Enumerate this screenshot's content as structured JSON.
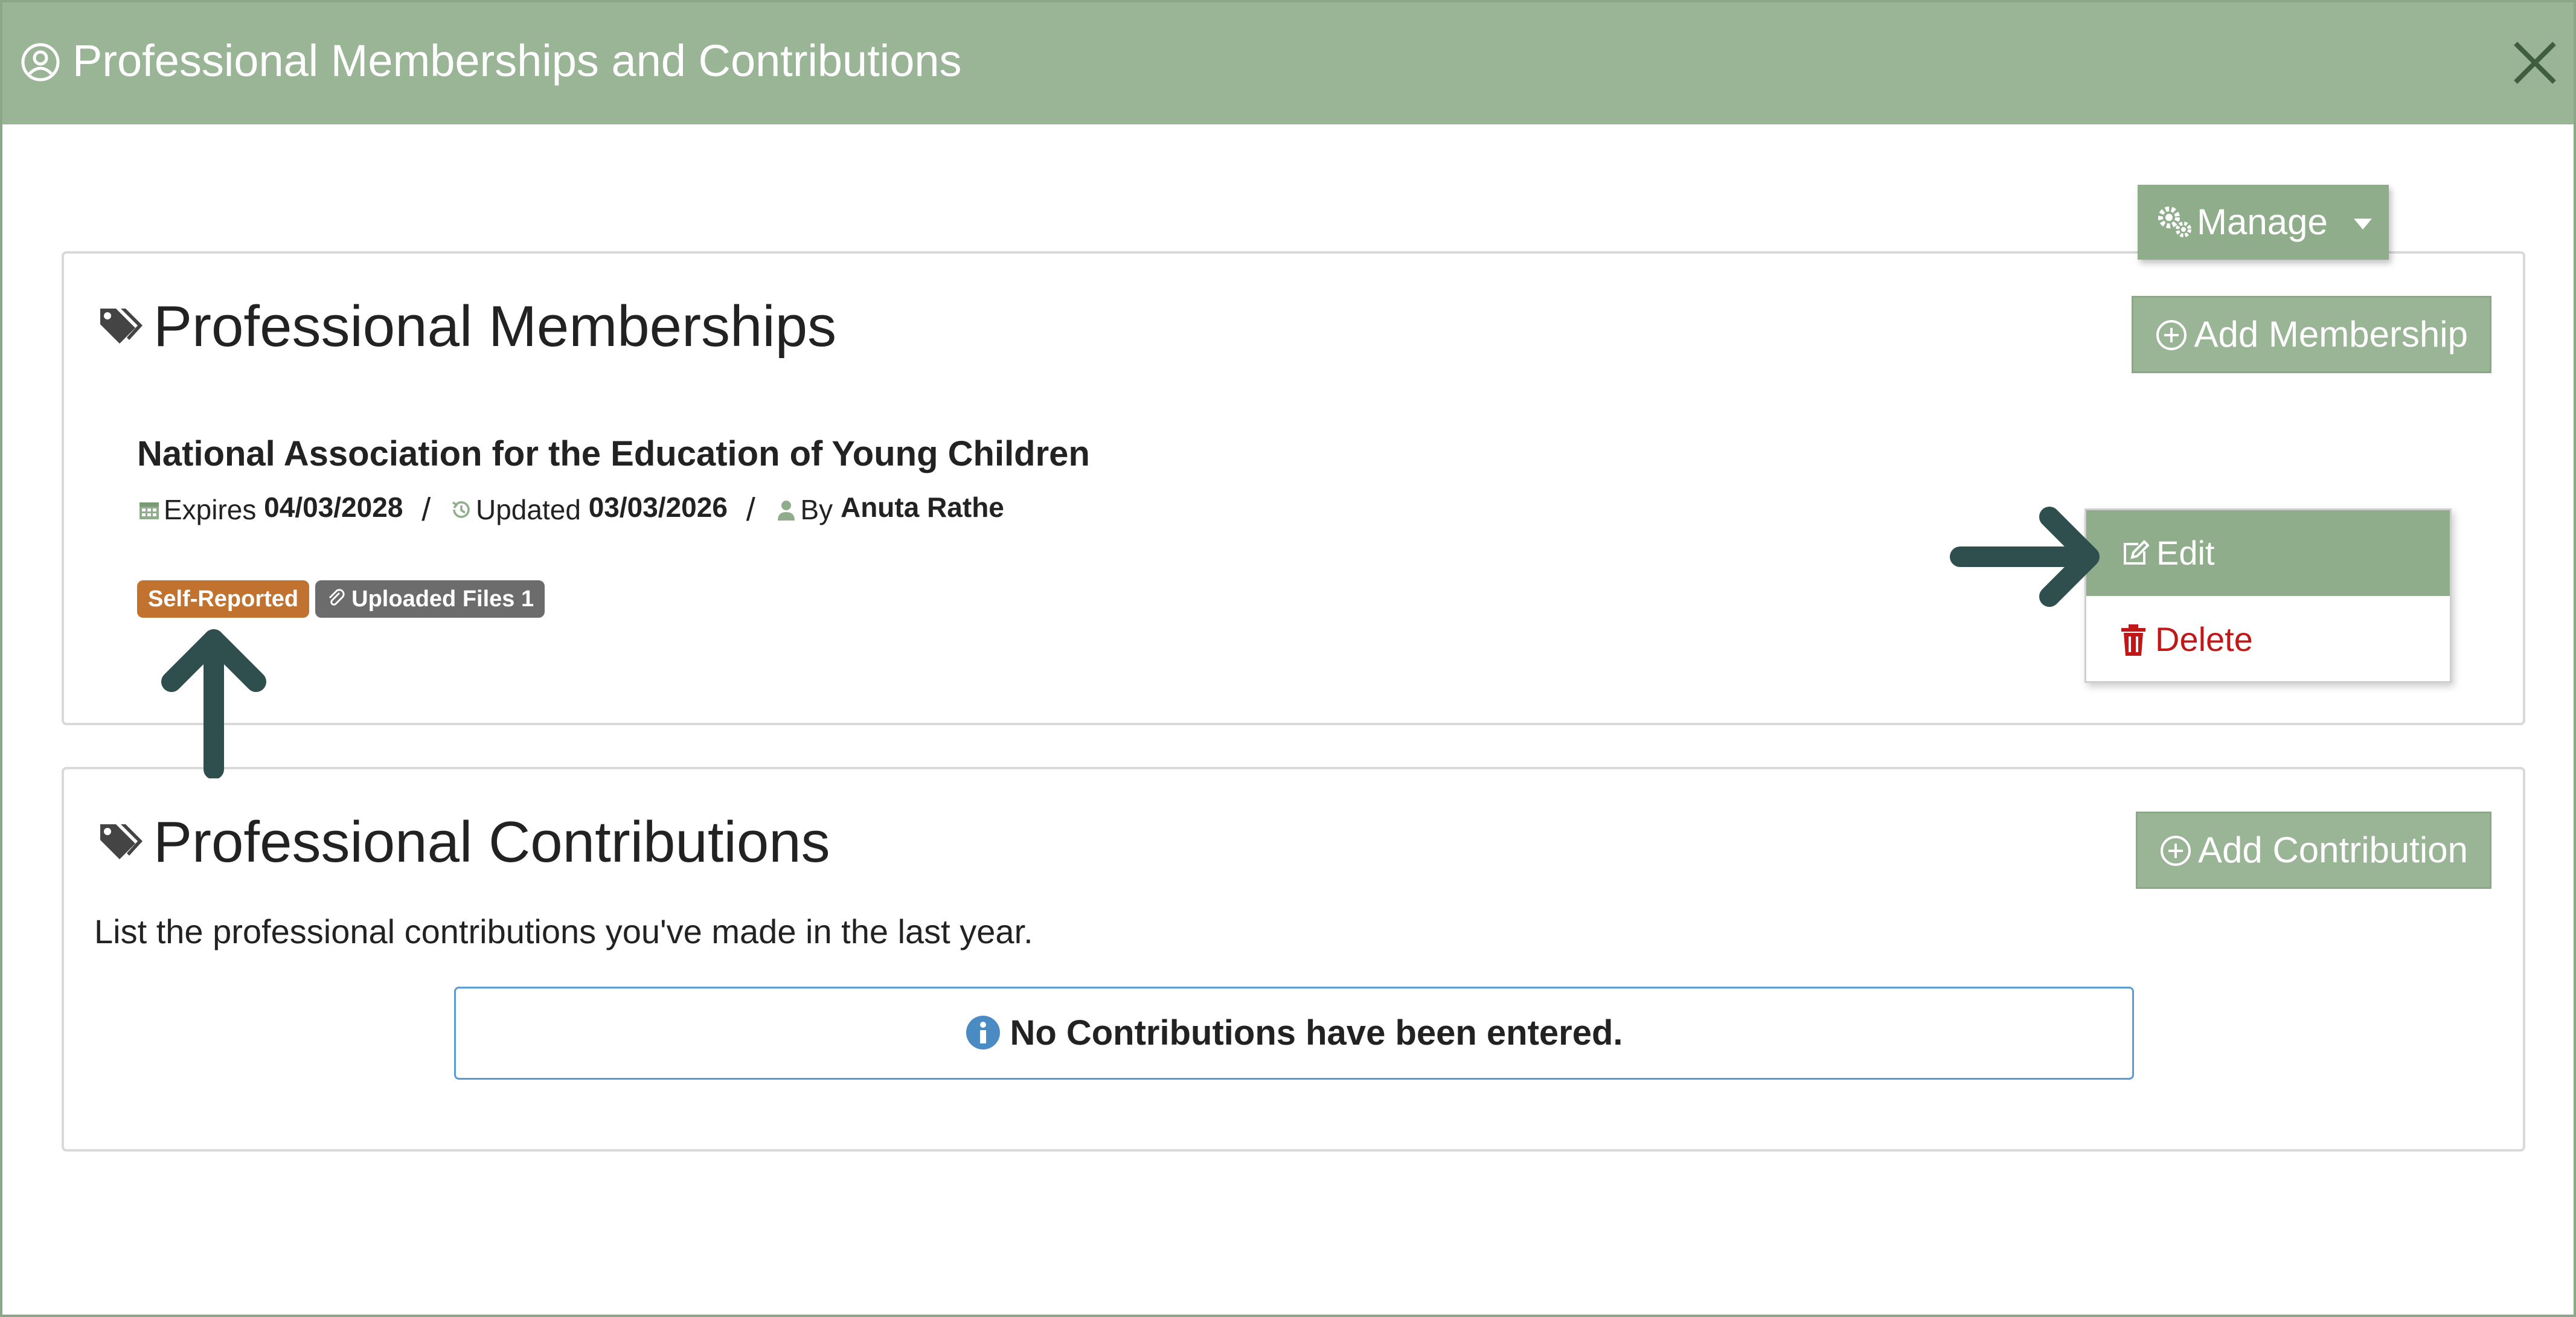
{
  "modal": {
    "title": "Professional Memberships and Contributions",
    "header_color": "#9ab596"
  },
  "memberships": {
    "title": "Professional Memberships",
    "add_label": "Add Membership",
    "item": {
      "name": "National Association for the Education of Young Children",
      "expires_label": "Expires",
      "expires_date": "04/03/2028",
      "updated_label": "Updated",
      "updated_date": "03/03/2026",
      "by_label": "By",
      "by_name": "Anuta Rathe",
      "badge_self": "Self-Reported",
      "badge_files": "Uploaded Files 1"
    },
    "manage_label": "Manage",
    "dropdown": {
      "edit_label": "Edit",
      "delete_label": "Delete"
    }
  },
  "contributions": {
    "title": "Professional Contributions",
    "add_label": "Add Contribution",
    "description": "List the professional contributions you've made in the last year.",
    "empty_message": "No Contributions have been entered."
  },
  "colors": {
    "accent": "#9ab596",
    "badge_self": "#c0722e",
    "badge_files": "#6c6c6c",
    "delete": "#c01818",
    "info": "#4a8bc4",
    "annotation_arrow": "#2f4f4f"
  }
}
